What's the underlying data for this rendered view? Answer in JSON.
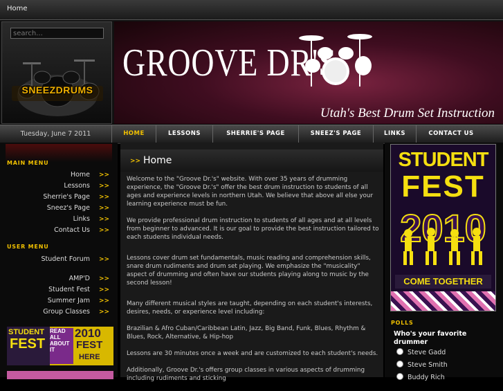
{
  "topbar": {
    "home_link": "Home"
  },
  "search": {
    "placeholder": "search..."
  },
  "logo": {
    "text": "SNEEZDRUMS"
  },
  "banner": {
    "title": "GROOVE DR'S",
    "subtitle": "Utah's Best Drum Set Instruction"
  },
  "date": "Tuesday, June 7 2011",
  "nav": [
    {
      "label": "HOME",
      "active": true
    },
    {
      "label": "LESSONS"
    },
    {
      "label": "SHERRIE'S PAGE"
    },
    {
      "label": "SNEEZ'S PAGE"
    },
    {
      "label": "LINKS"
    },
    {
      "label": "CONTACT US"
    }
  ],
  "main_menu": {
    "heading": "MAIN MENU",
    "items": [
      "Home",
      "Lessons",
      "Sherrie's Page",
      "Sneez's Page",
      "Links",
      "Contact Us"
    ]
  },
  "user_menu": {
    "heading": "USER MENU",
    "items": [
      "Student Forum",
      "AMP'D",
      "Student Fest",
      "Summer Jam",
      "Group Classes"
    ]
  },
  "arrow_symbol": ">>",
  "mini_ad": {
    "line1": "STUDENT",
    "line2": "FEST",
    "line3": "2010",
    "line4": "FEST",
    "line5": "HERE",
    "side": "READ ALL ABOUT IT"
  },
  "main": {
    "arrow": ">>",
    "title": "Home",
    "paragraphs": [
      "Welcome to the \"Groove Dr.'s\" website. With over 35 years of drumming experience, the \"Groove Dr.'s\" offer the best drum instruction to students of all ages and experience levels in northern Utah. We believe that above all else your learning experience must be fun.",
      "We provide professional drum instruction to students of all ages and at all levels from beginner to advanced. It is our goal to provide the best instruction tailored to each students individual needs.",
      "Lessons cover drum set fundamentals, music reading and comprehension skills, snare drum rudiments and drum set playing. We emphasize the \"musicality\" aspect of drumming and often have our students playing along to music by the second lesson!",
      "Many different musical styles are taught, depending on each student's interests, desires, needs, or experience level including:",
      "Brazilian & Afro Cuban/Caribbean Latin, Jazz, Big Band, Funk, Blues, Rhythm & Blues, Rock, Alternative, & Hip-hop",
      "Lessons are 30 minutes once a week and are customized to each student's needs.",
      "Additionally, Groove Dr.'s offers group classes in various aspects of drumming including rudiments and sticking"
    ]
  },
  "poster": {
    "line1": "STUDENT",
    "line2": "FEST",
    "line3": "2010",
    "line4": "COME TOGETHER"
  },
  "polls": {
    "heading": "POLLS",
    "question": "Who's your favorite drummer",
    "options": [
      "Steve Gadd",
      "Steve Smith",
      "Buddy Rich"
    ]
  },
  "colors": {
    "accent": "#f0c000",
    "background": "#000000",
    "banner": "#5a1530"
  }
}
